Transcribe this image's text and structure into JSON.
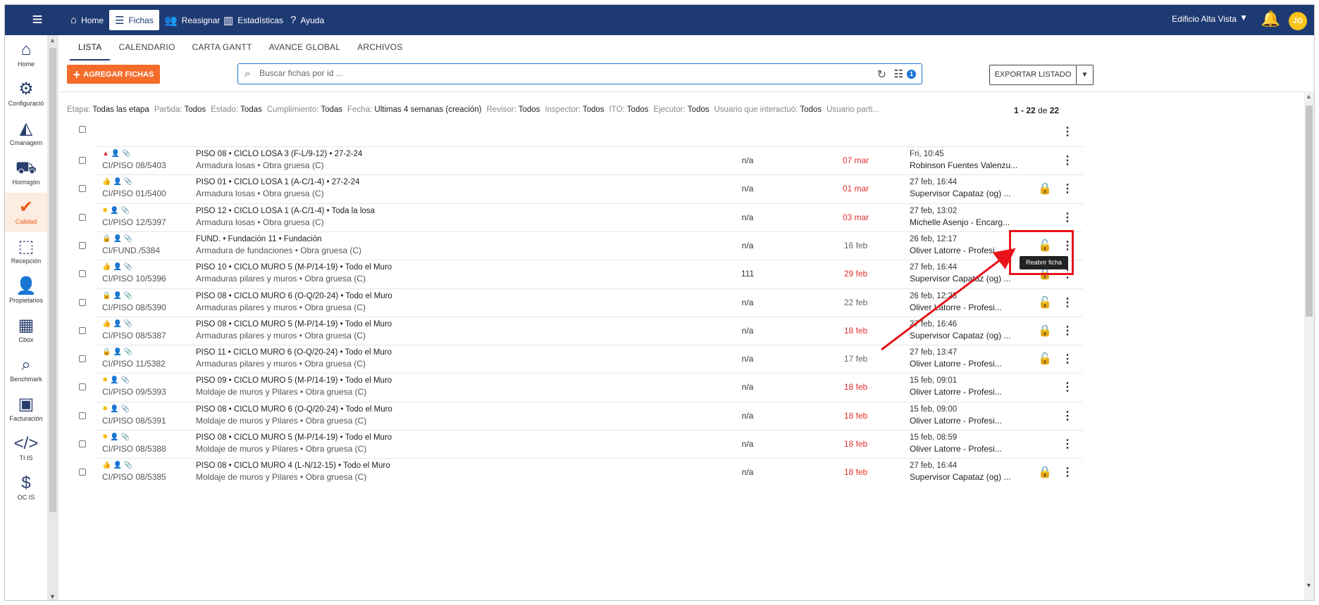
{
  "topbar": {
    "menu_icon": "menu-icon",
    "nav": [
      {
        "label": "Home",
        "icon": "home-icon"
      },
      {
        "label": "Fichas",
        "icon": "list-icon"
      },
      {
        "label": "Reasignar",
        "icon": "users-icon"
      },
      {
        "label": "Estadísticas",
        "icon": "chart-icon"
      },
      {
        "label": "Ayuda",
        "icon": "help-icon"
      }
    ],
    "building": "Edificio Alta Vista",
    "avatar_initials": "JG"
  },
  "sidebar": [
    {
      "label": "Home"
    },
    {
      "label": "Configuració"
    },
    {
      "label": "Cmanagem"
    },
    {
      "label": "Hormigón"
    },
    {
      "label": "Calidad"
    },
    {
      "label": "Recepción"
    },
    {
      "label": "Propietarios"
    },
    {
      "label": "Cbox"
    },
    {
      "label": "Benchmark"
    },
    {
      "label": "Facturación"
    },
    {
      "label": "TI IS"
    },
    {
      "label": "OC IS"
    }
  ],
  "tabs": [
    "LISTA",
    "CALENDARIO",
    "CARTA GANTT",
    "AVANCE GLOBAL",
    "ARCHIVOS"
  ],
  "toolbar": {
    "add_label": "AGREGAR FICHAS",
    "search_placeholder": "Buscar fichas por id ...",
    "filter_badge": "1",
    "export_label": "EXPORTAR LISTADO"
  },
  "filters": [
    {
      "k": "Etapa:",
      "v": "Todas las etapa"
    },
    {
      "k": "Partida:",
      "v": "Todos"
    },
    {
      "k": "Estado:",
      "v": "Todas"
    },
    {
      "k": "Cumplimiento:",
      "v": "Todas"
    },
    {
      "k": "Fecha:",
      "v": "Últimas 4 semanas (creación)"
    },
    {
      "k": "Revisor:",
      "v": "Todos"
    },
    {
      "k": "Inspector:",
      "v": "Todos"
    },
    {
      "k": "ITO:",
      "v": "Todos"
    },
    {
      "k": "Ejecutor:",
      "v": "Todos"
    },
    {
      "k": "Usuario que interactuó:",
      "v": "Todos"
    },
    {
      "k": "Usuario parti...",
      "v": ""
    }
  ],
  "pagination": {
    "range": "1 - 22",
    "of": "de",
    "total": "22"
  },
  "rows": [
    {
      "status": "warn",
      "id": "CI/PISO 08/5403",
      "title": "PISO 08 • CICLO LOSA 3 (F-L/9-12) • 27-2-24",
      "sub": "Armadura losas • Obra gruesa (C)",
      "na": "n/a",
      "date": "07 mar",
      "date_color": "red",
      "when": "Fri, 10:45",
      "who": "Robinson Fuentes Valenzu...",
      "lock": ""
    },
    {
      "status": "thumb",
      "id": "CI/PISO 01/5400",
      "title": "PISO 01 • CICLO LOSA 1 (A-C/1-4) • 27-2-24",
      "sub": "Armadura losas • Obra gruesa (C)",
      "na": "n/a",
      "date": "01 mar",
      "date_color": "red",
      "when": "27 feb, 16:44",
      "who": "Supervisor Capataz (og) ...",
      "lock": "closed"
    },
    {
      "status": "sun",
      "id": "CI/PISO 12/5397",
      "title": "PISO 12 • CICLO LOSA 1 (A-C/1-4) • Toda la losa",
      "sub": "Armadura losas • Obra gruesa (C)",
      "na": "n/a",
      "date": "03 mar",
      "date_color": "red",
      "when": "27 feb, 13:02",
      "who": "Michelle Asenjo - Encarg...",
      "lock": ""
    },
    {
      "status": "lock",
      "id": "CI/FUND./5384",
      "title": "FUND. • Fundación 11 • Fundación",
      "sub": "Armadura de fundaciones • Obra gruesa (C)",
      "na": "n/a",
      "date": "16 feb",
      "date_color": "grey",
      "when": "26 feb, 12:17",
      "who": "Oliver Latorre - Profesi...",
      "lock": "open"
    },
    {
      "status": "thumb",
      "id": "CI/PISO 10/5396",
      "title": "PISO 10 • CICLO MURO 5 (M-P/14-19) • Todo el Muro",
      "sub": "Armaduras pilares y muros • Obra gruesa (C)",
      "na": "111",
      "date": "29 feb",
      "date_color": "red",
      "when": "27 feb, 16:44",
      "who": "Supervisor Capataz (og) ...",
      "lock": "closed"
    },
    {
      "status": "lock",
      "id": "CI/PISO 08/5390",
      "title": "PISO 08 • CICLO MURO 6 (O-Q/20-24) • Todo el Muro",
      "sub": "Armaduras pilares y muros • Obra gruesa (C)",
      "na": "n/a",
      "date": "22 feb",
      "date_color": "grey",
      "when": "26 feb, 12:28",
      "who": "Oliver Latorre - Profesi...",
      "lock": "open"
    },
    {
      "status": "thumb",
      "id": "CI/PISO 08/5387",
      "title": "PISO 08 • CICLO MURO 5 (M-P/14-19) • Todo el Muro",
      "sub": "Armaduras pilares y muros • Obra gruesa (C)",
      "na": "n/a",
      "date": "18 feb",
      "date_color": "red",
      "when": "27 feb, 16:46",
      "who": "Supervisor Capataz (og) ...",
      "lock": "closed"
    },
    {
      "status": "lock",
      "id": "CI/PISO 11/5382",
      "title": "PISO 11 • CICLO MURO 6 (O-Q/20-24) • Todo el Muro",
      "sub": "Armaduras pilares y muros • Obra gruesa (C)",
      "na": "n/a",
      "date": "17 feb",
      "date_color": "grey",
      "when": "27 feb, 13:47",
      "who": "Oliver Latorre - Profesi...",
      "lock": "open"
    },
    {
      "status": "sun",
      "id": "CI/PISO 09/5393",
      "title": "PISO 09 • CICLO MURO 5 (M-P/14-19) • Todo el Muro",
      "sub": "Moldaje de muros y Pilares • Obra gruesa (C)",
      "na": "n/a",
      "date": "18 feb",
      "date_color": "red",
      "when": "15 feb, 09:01",
      "who": "Oliver Latorre - Profesi...",
      "lock": ""
    },
    {
      "status": "sun",
      "id": "CI/PISO 08/5391",
      "title": "PISO 08 • CICLO MURO 6 (O-Q/20-24) • Todo el Muro",
      "sub": "Moldaje de muros y Pilares • Obra gruesa (C)",
      "na": "n/a",
      "date": "18 feb",
      "date_color": "red",
      "when": "15 feb, 09:00",
      "who": "Oliver Latorre - Profesi...",
      "lock": ""
    },
    {
      "status": "sun",
      "id": "CI/PISO 08/5388",
      "title": "PISO 08 • CICLO MURO 5 (M-P/14-19) • Todo el Muro",
      "sub": "Moldaje de muros y Pilares • Obra gruesa (C)",
      "na": "n/a",
      "date": "18 feb",
      "date_color": "red",
      "when": "15 feb, 08:59",
      "who": "Oliver Latorre - Profesi...",
      "lock": ""
    },
    {
      "status": "thumb",
      "id": "CI/PISO 08/5385",
      "title": "PISO 08 • CICLO MURO 4 (L-N/12-15) • Todo el Muro",
      "sub": "Moldaje de muros y Pilares • Obra gruesa (C)",
      "na": "n/a",
      "date": "18 feb",
      "date_color": "red",
      "when": "27 feb, 16:44",
      "who": "Supervisor Capataz (og) ...",
      "lock": "closed"
    }
  ],
  "tooltip": "Reabrir ficha",
  "colors": {
    "topbar": "#1e3a72",
    "accent": "#f46b2a",
    "overdue": "#e03030",
    "highlight": "#e8141a"
  }
}
